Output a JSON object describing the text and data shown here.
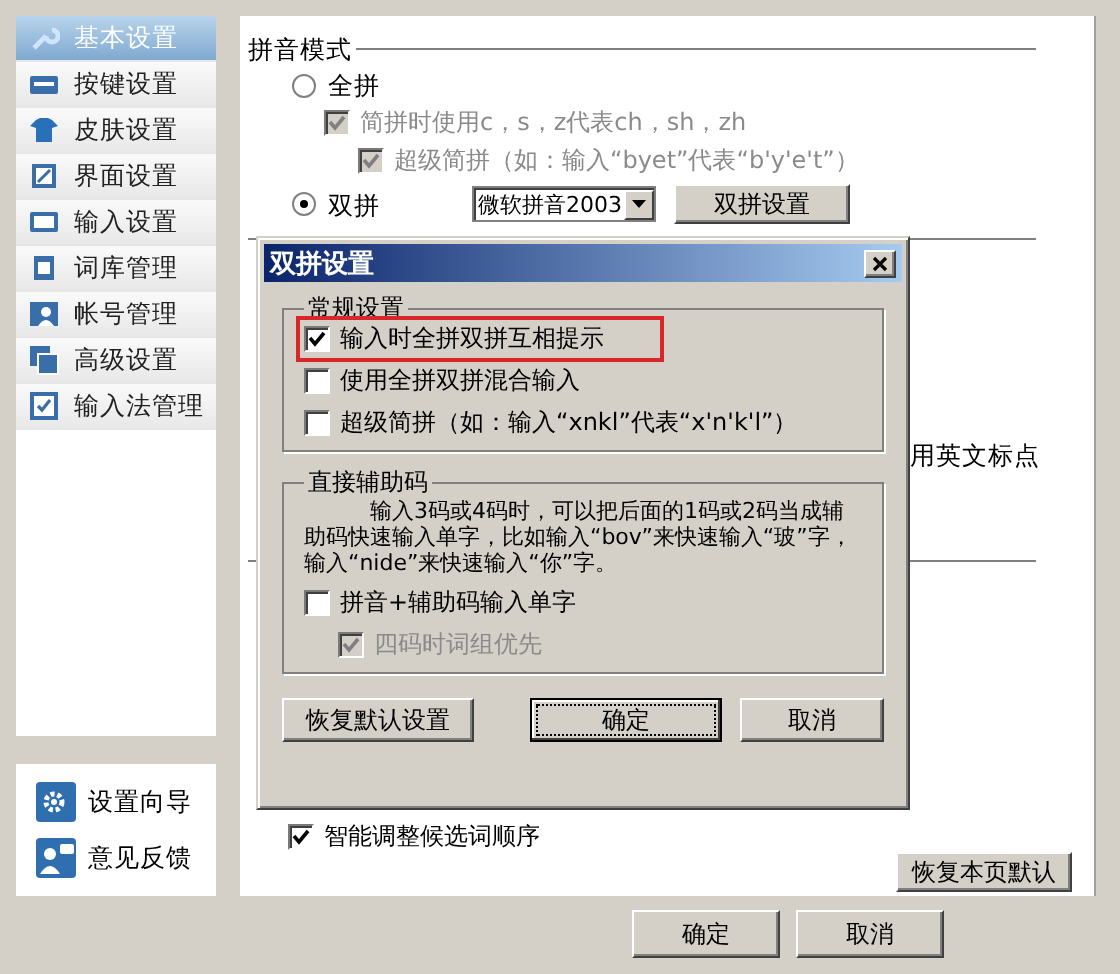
{
  "sidebar": {
    "items": [
      {
        "label": "基本设置",
        "selected": true
      },
      {
        "label": "按键设置",
        "selected": false
      },
      {
        "label": "皮肤设置",
        "selected": false
      },
      {
        "label": "界面设置",
        "selected": false
      },
      {
        "label": "输入设置",
        "selected": false
      },
      {
        "label": "词库管理",
        "selected": false
      },
      {
        "label": "帐号管理",
        "selected": false
      },
      {
        "label": "高级设置",
        "selected": false
      },
      {
        "label": "输入法管理",
        "selected": false
      }
    ],
    "links": [
      {
        "label": "设置向导"
      },
      {
        "label": "意见反馈"
      }
    ]
  },
  "pinyin_mode": {
    "heading": "拼音模式",
    "options": [
      {
        "label": "全拼",
        "selected": false,
        "children": [
          {
            "label": "简拼时使用c，s，z代表ch，sh，zh",
            "checked": true,
            "disabled": true,
            "children": [
              {
                "label": "超级简拼（如：输入“byet”代表“b'y'e't”）",
                "checked": true,
                "disabled": true
              }
            ]
          }
        ]
      },
      {
        "label": "双拼",
        "selected": true
      }
    ],
    "scheme_select": {
      "value": "微软拼音2003"
    },
    "scheme_button": "双拼设置"
  },
  "hidden_tail_label": "用英文标点",
  "smart_order": {
    "label": "智能调整候选词顺序",
    "checked": true
  },
  "restore_page_button": "恢复本页默认",
  "buttons": [
    "确定",
    "取消"
  ],
  "dialog": {
    "title": "双拼设置",
    "groups": [
      {
        "title": "常规设置",
        "options": [
          {
            "label": "输入时全拼双拼互相提示",
            "checked": true,
            "disabled": false,
            "highlighted": true
          },
          {
            "label": "使用全拼双拼混合输入",
            "checked": false,
            "disabled": false,
            "highlighted": false
          },
          {
            "label": "超级简拼（如：输入“xnkl”代表“x'n'k'l”）",
            "checked": false,
            "disabled": false,
            "highlighted": false
          }
        ]
      },
      {
        "title": "直接辅助码",
        "description": "输入3码或4码时，可以把后面的1码或2码当成辅助码快速输入单字，比如输入“bov”来快速输入“玻”字，输入“nide”来快速输入“你”字。",
        "options": [
          {
            "label": "拼音+辅助码输入单字",
            "checked": false,
            "disabled": false,
            "highlighted": false,
            "children": [
              {
                "label": "四码时词组优先",
                "checked": true,
                "disabled": true,
                "highlighted": false
              }
            ]
          }
        ]
      }
    ],
    "buttons": [
      {
        "label": "恢复默认设置",
        "focused": false
      },
      {
        "label": "确定",
        "focused": true
      },
      {
        "label": "取消",
        "focused": false
      }
    ]
  }
}
